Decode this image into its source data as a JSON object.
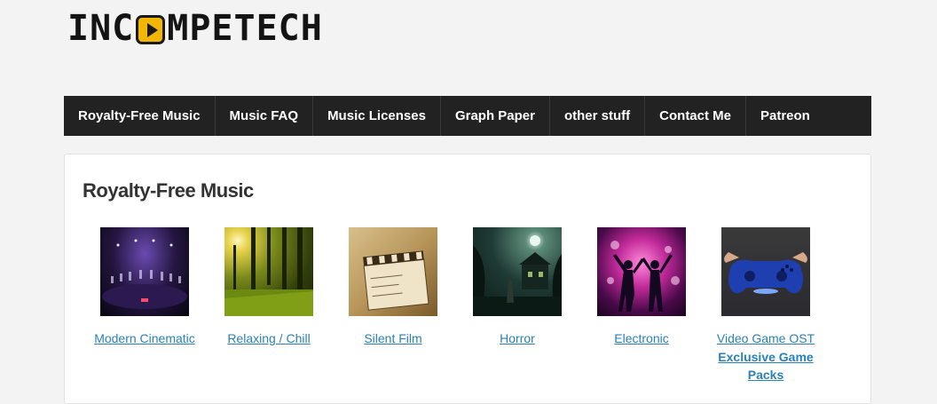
{
  "logo": {
    "text_before": "INC",
    "text_after": "MPETECH",
    "icon": "play-icon",
    "accent": "#f2b705"
  },
  "nav": {
    "items": [
      {
        "label": "Royalty-Free Music"
      },
      {
        "label": "Music FAQ"
      },
      {
        "label": "Music Licenses"
      },
      {
        "label": "Graph Paper"
      },
      {
        "label": "other stuff"
      },
      {
        "label": "Contact Me"
      },
      {
        "label": "Patreon"
      }
    ]
  },
  "main": {
    "title": "Royalty-Free Music",
    "categories": [
      {
        "label": "Modern Cinematic"
      },
      {
        "label": "Relaxing / Chill"
      },
      {
        "label": "Silent Film"
      },
      {
        "label": "Horror"
      },
      {
        "label": "Electronic"
      },
      {
        "label": "Video Game OST",
        "extra": "Exclusive Game Packs"
      }
    ]
  },
  "colors": {
    "nav_bg": "#222222",
    "link": "#2a80b9",
    "page_bg": "#f3f3f3"
  }
}
